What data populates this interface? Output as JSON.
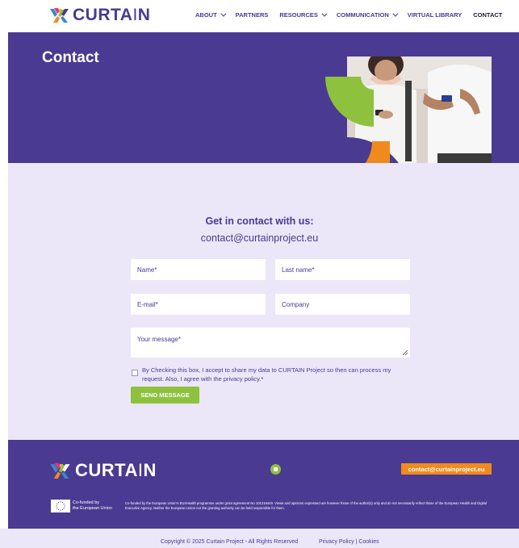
{
  "brand": {
    "name_bold": "CURTA",
    "name_thin": "I",
    "name_end": "N"
  },
  "nav": {
    "items": [
      {
        "label": "ABOUT",
        "has_dropdown": true
      },
      {
        "label": "PARTNERS",
        "has_dropdown": false
      },
      {
        "label": "RESOURCES",
        "has_dropdown": true
      },
      {
        "label": "COMMUNICATION",
        "has_dropdown": true
      },
      {
        "label": "VIRTUAL LIBRARY",
        "has_dropdown": false
      },
      {
        "label": "CONTACT",
        "has_dropdown": false,
        "active": true
      }
    ]
  },
  "hero": {
    "title": "Contact"
  },
  "contact": {
    "heading": "Get in contact with us:",
    "email": "contact@curtainproject.eu"
  },
  "form": {
    "name_placeholder": "Name*",
    "lastname_placeholder": "Last name*",
    "email_placeholder": "E-mail*",
    "company_placeholder": "Company",
    "message_placeholder": "Your message*",
    "consent_text": "By Checking this box, I accept to share my data to CURTAIN Project so then can process my request. Also, I agree with the privacy policy.*",
    "consent_checked": false,
    "submit_label": "SEND MESSAGE"
  },
  "footer": {
    "email": "contact@curtainproject.eu",
    "eu_line1": "Co-funded by",
    "eu_line2": "the European Union",
    "disclaimer": "Co-funded by the European Union's EU4Health programme under grant agreement No 101219449. Views and opinions expressed are however those of the author(s) only and do not necessarily reflect those of the European Health and Digital Executive Agency. Neither the European Union nor the granting authority can be held responsible for them.",
    "copyright": "Copyright © 2025 Curtain Project - All Rights Reserved",
    "privacy": "Privacy Policy",
    "cookies": "Cookies",
    "separator": "|"
  },
  "colors": {
    "brand_purple": "#4a3a92",
    "light_lavender": "#ebe7f8",
    "accent_green": "#8dc13e",
    "accent_orange": "#f08a1e",
    "logo_blue": "#3f86c8",
    "logo_pink": "#e2368b",
    "logo_yellow": "#f4c21a"
  },
  "icons": [
    "curtain-logo-icon",
    "chevron-down-icon",
    "linkedin-icon",
    "eu-flag-icon",
    "resize-handle-icon"
  ]
}
